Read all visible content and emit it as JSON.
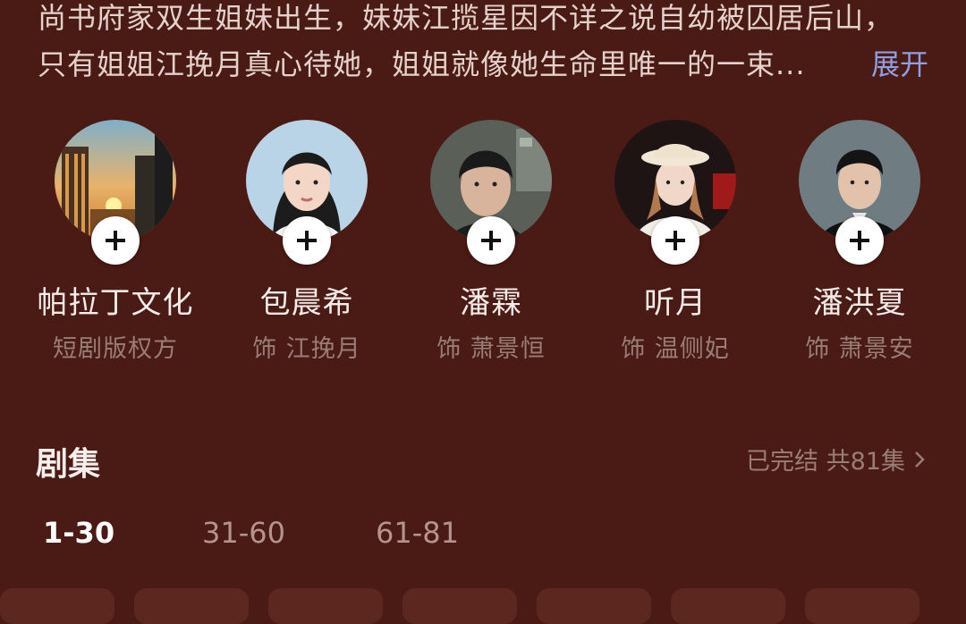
{
  "synopsis": {
    "line1": "尚书府家双生姐妹出生，妹妹江揽星因不详之说自幼被囚居后山，",
    "line2": "只有姐姐江挽月真心待她，姐姐就像她生命里唯一的一束...",
    "expand_label": "展开"
  },
  "cast": [
    {
      "name": "帕拉丁文化",
      "role": "短剧版权方",
      "avatar": "sunset-skyline"
    },
    {
      "name": "包晨希",
      "role": "饰 江挽月",
      "avatar": "actress-portrait"
    },
    {
      "name": "潘霖",
      "role": "饰 萧景恒",
      "avatar": "actor-portrait"
    },
    {
      "name": "听月",
      "role": "饰 温侧妃",
      "avatar": "actress-hat-portrait"
    },
    {
      "name": "潘洪夏",
      "role": "饰 萧景安",
      "avatar": "actor-portrait-2"
    }
  ],
  "episodes": {
    "title": "剧集",
    "status": "已完结 共81集",
    "ranges": [
      "1-30",
      "31-60",
      "61-81"
    ],
    "active_range": 0
  },
  "colors": {
    "background": "#4a1a14",
    "accent_link": "#8f9fe0",
    "muted_text": "#9a7d77"
  }
}
